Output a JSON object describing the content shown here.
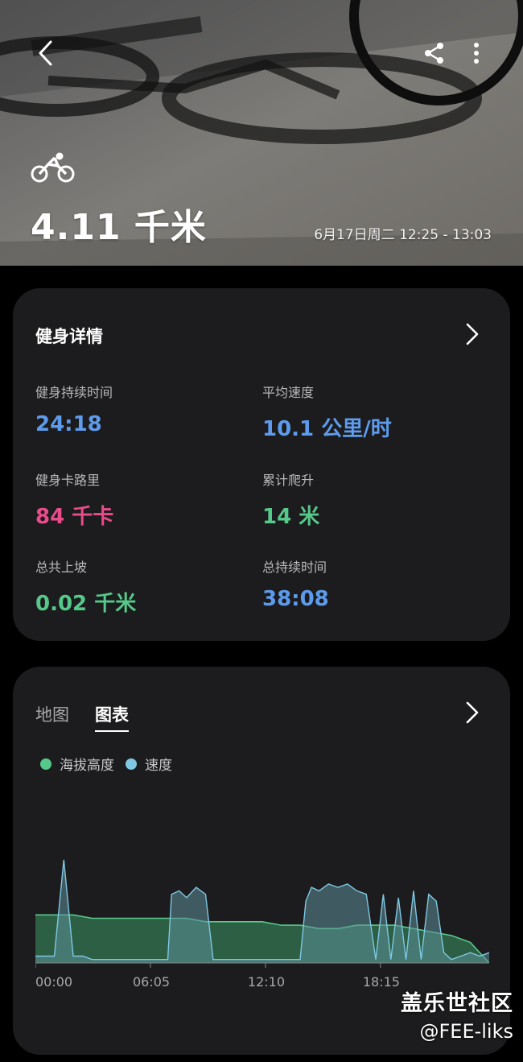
{
  "header": {
    "distance": "4.11 千米",
    "date_range": "6月17日周二 12:25 - 13:03"
  },
  "icons": {
    "back": "chevron-left-icon",
    "share": "share-icon",
    "more": "more-vertical-icon",
    "activity": "bicycle-icon"
  },
  "fitness_details": {
    "title": "健身详情",
    "stats": [
      {
        "label": "健身持续时间",
        "value": "24:18",
        "color": "#5d9cec"
      },
      {
        "label": "平均速度",
        "value": "10.1 公里/时",
        "color": "#5d9cec"
      },
      {
        "label": "健身卡路里",
        "value": "84 千卡",
        "color": "#e84c8a"
      },
      {
        "label": "累计爬升",
        "value": "14 米",
        "color": "#56c98a"
      },
      {
        "label": "总共上坡",
        "value": "0.02 千米",
        "color": "#56c98a"
      },
      {
        "label": "总持续时间",
        "value": "38:08",
        "color": "#5d9cec"
      }
    ]
  },
  "chart_card": {
    "tabs": [
      {
        "label": "地图",
        "active": false
      },
      {
        "label": "图表",
        "active": true
      }
    ]
  },
  "chart_data": {
    "type": "area",
    "title": "",
    "xlabel": "",
    "ylabel": "",
    "x_tick_labels": [
      "00:00",
      "06:05",
      "12:10",
      "18:15"
    ],
    "legend_position": "top-left",
    "grid": false,
    "series": [
      {
        "name": "海拔高度",
        "color": "#56c98a",
        "x_minutes": [
          0,
          1,
          2,
          3,
          4,
          5,
          6,
          7,
          8,
          9,
          10,
          11,
          12,
          13,
          14,
          15,
          16,
          17,
          18,
          19,
          20,
          21,
          22,
          23,
          24
        ],
        "values": [
          14,
          14,
          14,
          13,
          13,
          13,
          13,
          13,
          13,
          12,
          12,
          12,
          12,
          11,
          11,
          10,
          10,
          11,
          11,
          11,
          10,
          9,
          8,
          6,
          0
        ]
      },
      {
        "name": "速度",
        "color": "#7ec8e3",
        "x_minutes": [
          0,
          1,
          1.5,
          2,
          2.5,
          3,
          4,
          5,
          6,
          7,
          7.2,
          7.6,
          8,
          8.5,
          9,
          9.4,
          9.6,
          10,
          11,
          12,
          13,
          14,
          14.3,
          14.6,
          15,
          15.5,
          16,
          16.5,
          17,
          17.5,
          18,
          18.4,
          18.8,
          19.2,
          19.6,
          20,
          20.4,
          20.8,
          21.2,
          21.6,
          22,
          22.5,
          23,
          23.5,
          24
        ],
        "values": [
          2,
          2,
          30,
          2,
          2,
          1,
          1,
          1,
          1,
          1,
          20,
          21,
          19,
          22,
          20,
          1,
          1,
          1,
          1,
          1,
          1,
          1,
          18,
          22,
          21,
          23,
          22,
          23,
          21,
          20,
          1,
          20,
          1,
          19,
          1,
          21,
          1,
          20,
          18,
          3,
          1,
          2,
          3,
          2,
          3
        ]
      }
    ]
  },
  "watermark": {
    "line1": "盖乐世社区",
    "line2": "@FEE-liks"
  }
}
